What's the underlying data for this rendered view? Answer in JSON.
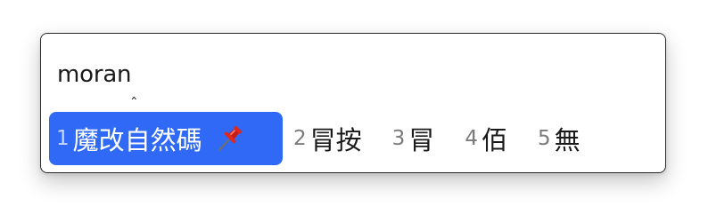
{
  "input_panel": {
    "preedit_text": "moran",
    "caret_glyph": "‸"
  },
  "candidates": [
    {
      "index": "1",
      "text": "魔改自然碼",
      "selected": true,
      "pinned": true
    },
    {
      "index": "2",
      "text": "冐按",
      "selected": false
    },
    {
      "index": "3",
      "text": "冐",
      "selected": false
    },
    {
      "index": "4",
      "text": "佰",
      "selected": false
    },
    {
      "index": "5",
      "text": "無",
      "selected": false
    }
  ],
  "colors": {
    "highlight": "#2f69f5",
    "index_text": "#7a7a7a",
    "candidate_text": "#1a1a1a",
    "border": "#2b2b2b"
  },
  "icons": {
    "pinned": "pushpin-icon"
  }
}
